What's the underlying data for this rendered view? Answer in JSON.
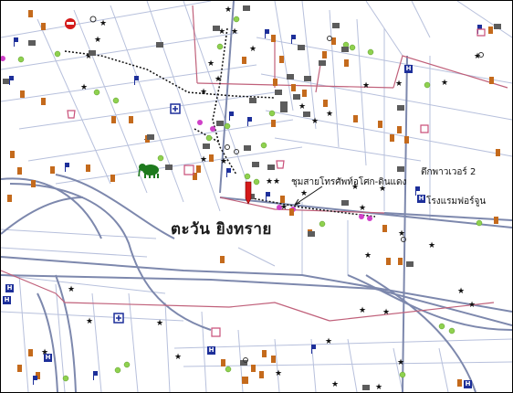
{
  "map": {
    "area_label": "ตะวัน ยิงทราย",
    "callout_label": "ชุมสายโทรศัพท์อโศก-ดินแดง",
    "tower_label": "ตึกพาวเวอร์ 2",
    "hotel_label": "โรงแรมฟอร์จูน",
    "hotel_icon_text": "H"
  },
  "icons": {
    "temple": "temple-icon",
    "school": "school-icon",
    "hospital": "hospital-cross-icon",
    "hotel": "hotel-h-icon",
    "flag": "government-flag-icon",
    "park": "green-dot-icon",
    "star": "star-icon",
    "elephant": "elephant-landmark-icon",
    "pin": "location-pin-icon"
  },
  "colors": {
    "road": "#9aa6c8",
    "road_dark": "#4a4a4a",
    "district_boundary": "#c0607a",
    "temple": "#c46a1c",
    "school": "#6b6b6b",
    "blue_icon": "#1d2f9a",
    "park": "#8fd14f",
    "pink": "#d040c8",
    "elephant": "#1e7a1e"
  }
}
